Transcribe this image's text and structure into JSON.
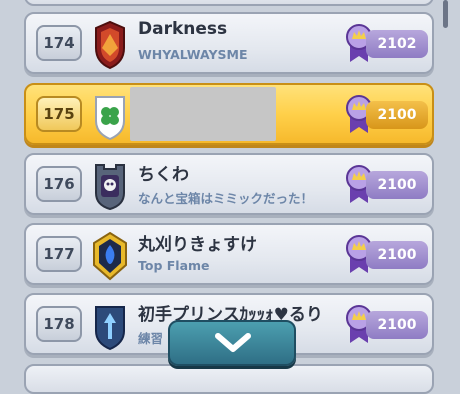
{
  "rows": [
    {
      "rank": "174",
      "name": "Darkness",
      "clan": "WHYALWAYSME",
      "trophies": "2102",
      "badge": "flame-badge-icon"
    },
    {
      "rank": "175",
      "name": "",
      "clan": "",
      "trophies": "2100",
      "badge": "clover-badge-icon",
      "highlighted": true
    },
    {
      "rank": "176",
      "name": "ちくわ",
      "clan": "なんと宝箱はミミックだった！",
      "trophies": "2100",
      "badge": "skull-badge-icon"
    },
    {
      "rank": "177",
      "name": "丸刈りきょすけ",
      "clan": "Top Flame",
      "trophies": "2100",
      "badge": "fire-badge-icon"
    },
    {
      "rank": "178",
      "name": "初手プリンスｶｯｯｫ♥るり",
      "clan": "練習",
      "trophies": "2100",
      "badge": "arrow-badge-icon"
    }
  ],
  "colors": {
    "row_bg": "#e4e8ef",
    "highlight_bg": "#ffd04a",
    "score_pill": "#8f7cc4",
    "accent_blue": "#6d86a8",
    "button": "#2f6f86"
  },
  "scroll_button": {
    "icon": "chevron-down-icon"
  }
}
